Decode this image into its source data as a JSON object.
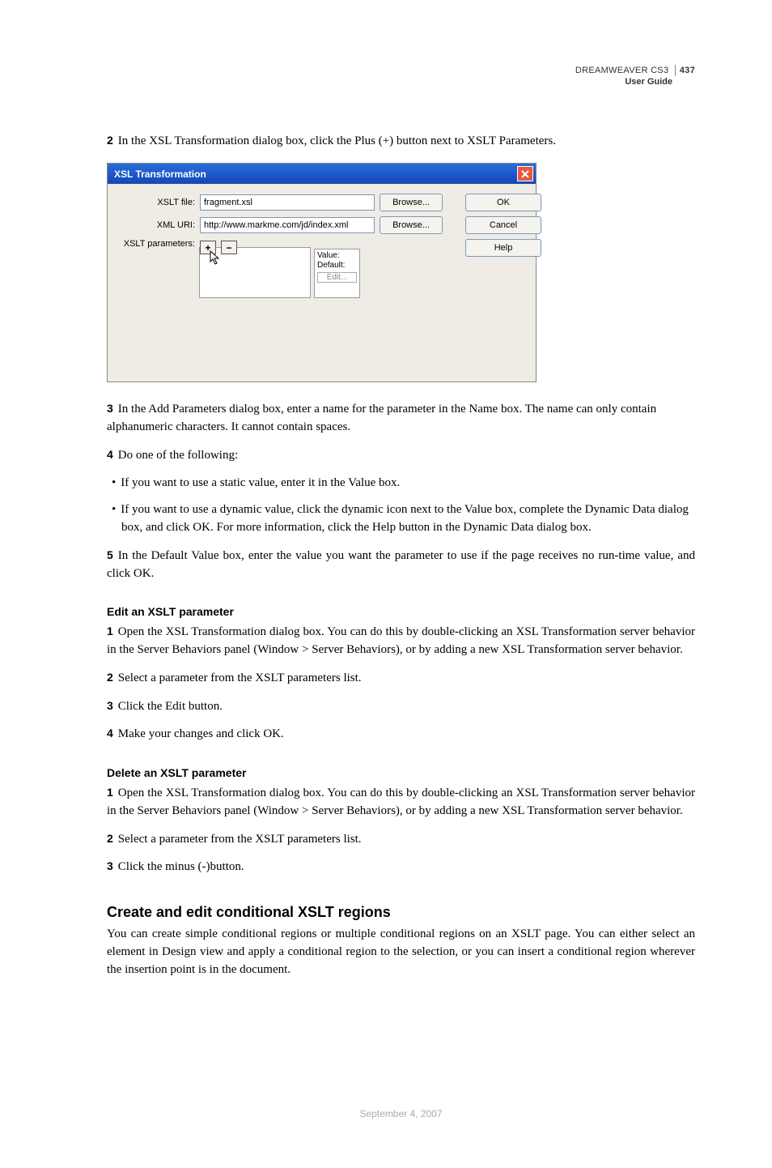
{
  "header": {
    "product": "DREAMWEAVER CS3",
    "page_num": "437",
    "sub": "User Guide"
  },
  "step2": {
    "n": "2",
    "t": "In the XSL Transformation dialog box, click the Plus (+) button next to XSLT Parameters."
  },
  "dialog": {
    "title": "XSL Transformation",
    "labels": {
      "file": "XSLT file:",
      "uri": "XML URI:",
      "params": "XSLT parameters:"
    },
    "values": {
      "file": "fragment.xsl",
      "uri": "http://www.markme.com/jd/index.xml"
    },
    "browse": "Browse...",
    "plus": "+",
    "minus": "−",
    "detail": {
      "value": "Value:",
      "default": "Default:",
      "edit": "Edit..."
    },
    "btns": {
      "ok": "OK",
      "cancel": "Cancel",
      "help": "Help"
    }
  },
  "step3": {
    "n": "3",
    "t": "In the Add Parameters dialog box, enter a name for the parameter in the Name box. The name can only contain alphanumeric characters. It cannot contain spaces."
  },
  "step4": {
    "n": "4",
    "t": "Do one of the following:"
  },
  "b1": "If you want to use a static value, enter it in the Value box.",
  "b2": "If you want to use a dynamic value, click the dynamic icon next to the Value box, complete the Dynamic Data dialog box, and click OK. For more information, click the Help button in the Dynamic Data dialog box.",
  "step5": {
    "n": "5",
    "t": "In the Default Value box, enter the value you want the parameter to use if the page receives no run-time value, and click OK."
  },
  "edit": {
    "head": "Edit an XSLT parameter",
    "s1": {
      "n": "1",
      "t": "Open the XSL Transformation dialog box. You can do this by double-clicking an XSL Transformation server behavior in the Server Behaviors panel (Window > Server Behaviors), or by adding a new XSL Transformation server behavior."
    },
    "s2": {
      "n": "2",
      "t": "Select a parameter from the XSLT parameters list."
    },
    "s3": {
      "n": "3",
      "t": "Click the Edit button."
    },
    "s4": {
      "n": "4",
      "t": "Make your changes and click OK."
    }
  },
  "del": {
    "head": "Delete an XSLT parameter",
    "s1": {
      "n": "1",
      "t": "Open the XSL Transformation dialog box. You can do this by double-clicking an XSL Transformation server behavior in the Server Behaviors panel (Window > Server Behaviors), or by adding a new XSL Transformation server behavior."
    },
    "s2": {
      "n": "2",
      "t": "Select a parameter from the XSLT parameters list."
    },
    "s3": {
      "n": "3",
      "t": "Click the minus (-)button."
    }
  },
  "cond": {
    "head": "Create and edit conditional XSLT regions",
    "p": "You can create simple conditional regions or multiple conditional regions on an XSLT page. You can either select an element in Design view and apply a conditional region to the selection, or you can insert a conditional region wherever the insertion point is in the document."
  },
  "footer": "September 4, 2007"
}
